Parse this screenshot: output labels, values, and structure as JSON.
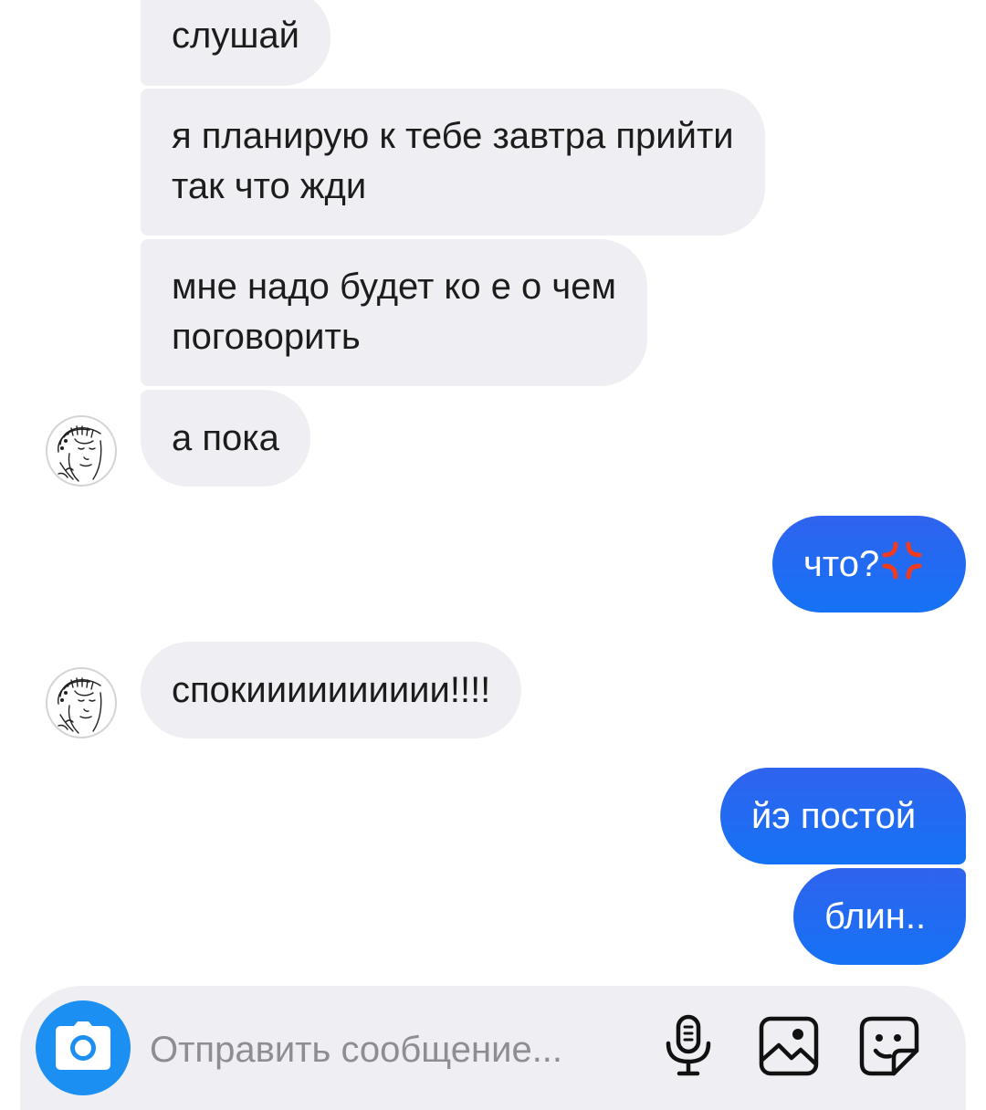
{
  "messages": [
    {
      "id": "m1",
      "direction": "incoming",
      "lines": [
        "слушай"
      ]
    },
    {
      "id": "m2",
      "direction": "incoming",
      "lines": [
        "я планирую к тебе завтра прийти",
        "так что жди"
      ]
    },
    {
      "id": "m3",
      "direction": "incoming",
      "lines": [
        "мне надо будет ко е о чем",
        "поговорить"
      ]
    },
    {
      "id": "m4",
      "direction": "incoming",
      "lines": [
        "а пока"
      ],
      "avatar": "contact-avatar"
    },
    {
      "id": "m5",
      "direction": "outgoing",
      "lines": [
        "что?"
      ],
      "emoji": "anger-symbol-emoji"
    },
    {
      "id": "m6",
      "direction": "incoming",
      "lines": [
        "спокииииииииии!!!!"
      ],
      "avatar": "contact-avatar"
    },
    {
      "id": "m7",
      "direction": "outgoing",
      "lines": [
        "йэ постой"
      ]
    },
    {
      "id": "m8",
      "direction": "outgoing",
      "lines": [
        "блин.."
      ]
    }
  ],
  "composer": {
    "placeholder": "Отправить сообщение...",
    "camera_icon": "camera-icon",
    "mic_icon": "microphone-icon",
    "gallery_icon": "image-gallery-icon",
    "sticker_icon": "sticker-icon"
  },
  "colors": {
    "incoming_bubble": "#efeef2",
    "outgoing_bubble": "#1572f5",
    "camera_button": "#1b8ff2",
    "anger_emoji": "#f23b1e"
  }
}
